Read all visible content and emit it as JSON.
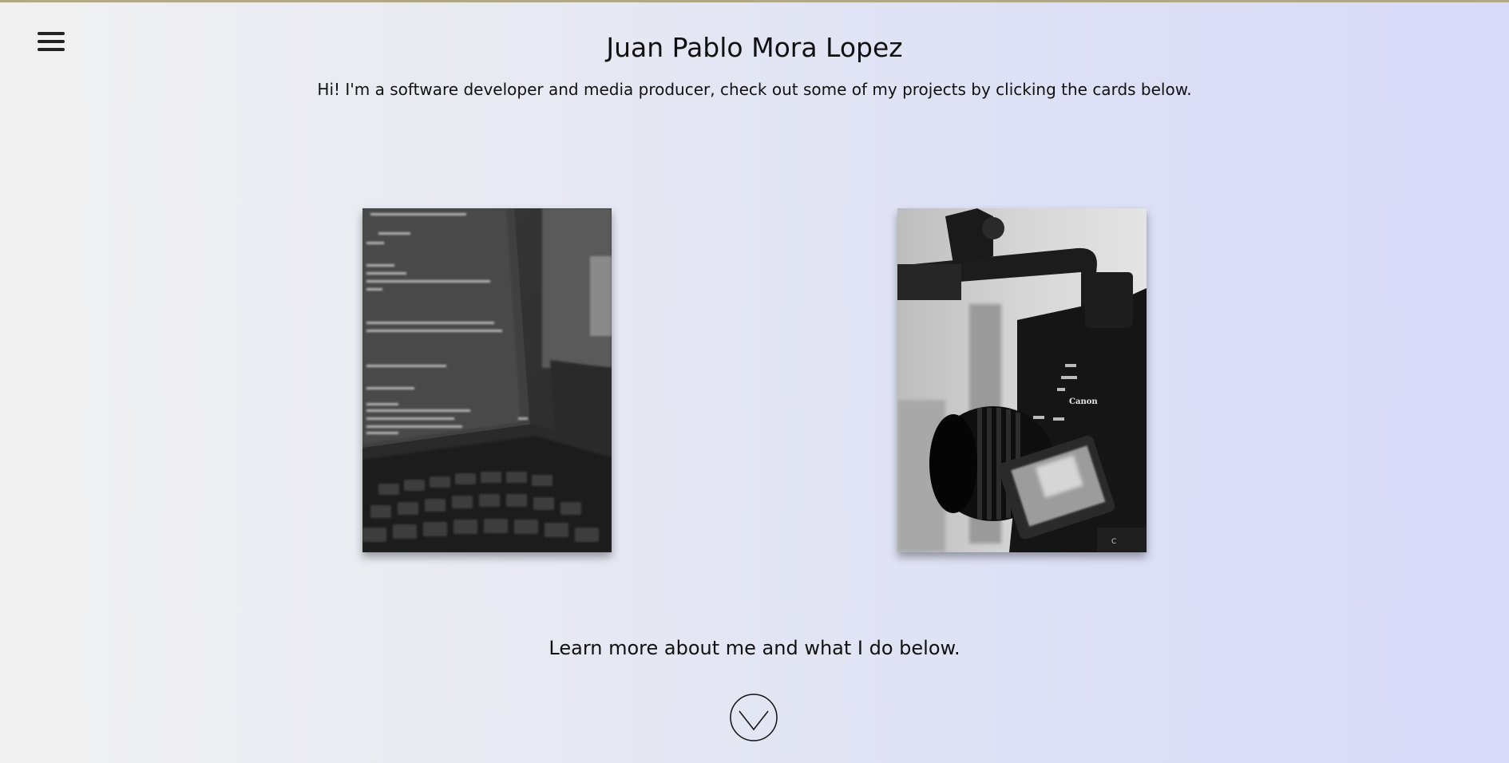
{
  "header": {
    "title": "Juan Pablo Mora Lopez",
    "subtitle": "Hi! I'm a software developer and media producer, check out some of my projects by clicking the cards below."
  },
  "menu": {
    "icon": "hamburger-menu-icon"
  },
  "cards": [
    {
      "name": "software-card",
      "image": "laptop-code-photo"
    },
    {
      "name": "media-card",
      "image": "canon-video-camera-photo"
    }
  ],
  "footer": {
    "learn_more": "Learn more about me and what I do below.",
    "scroll_icon": "chevron-down-circle-icon"
  },
  "colors": {
    "background_left": "#f1f1f1",
    "background_right": "#d8dbf8",
    "top_border": "#b0a886",
    "text": "#111111"
  }
}
